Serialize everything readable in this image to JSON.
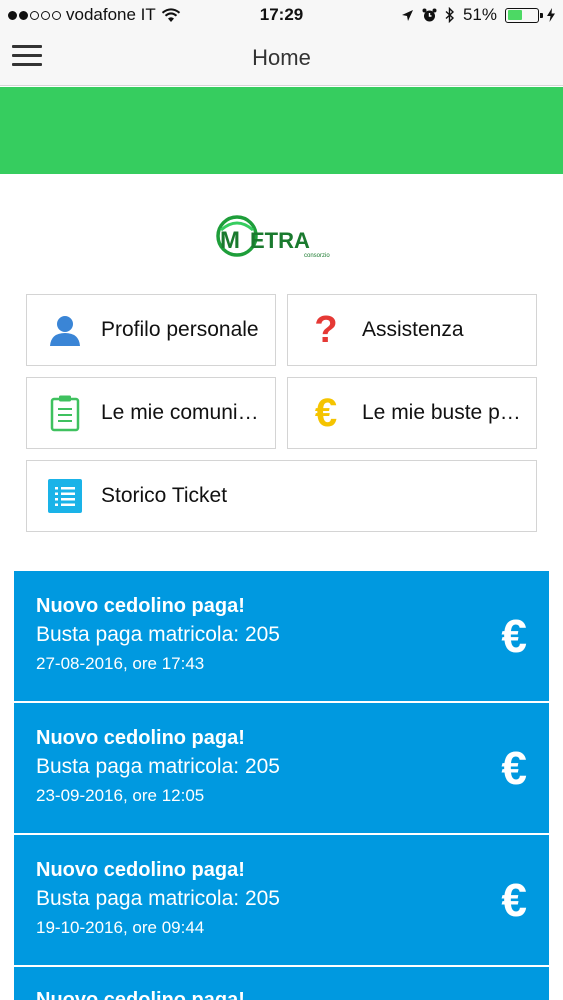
{
  "status_bar": {
    "carrier": "vodafone IT",
    "time": "17:29",
    "battery": "51%",
    "battery_level": 0.51
  },
  "navbar": {
    "title": "Home",
    "menu_icon": "hamburger-menu-icon"
  },
  "logo": {
    "brand": "METRA",
    "tagline": "consorzio"
  },
  "tiles": [
    {
      "label": "Profilo personale",
      "icon": "person-icon",
      "color": "#3a85d6"
    },
    {
      "label": "Assistenza",
      "icon": "question-icon",
      "color": "#e53935"
    },
    {
      "label": "Le mie comunicazioni",
      "icon": "clipboard-icon",
      "color": "#3fc15f"
    },
    {
      "label": "Le mie buste paga",
      "icon": "euro-icon",
      "color": "#f5c400"
    },
    {
      "label": "Storico Ticket",
      "icon": "list-icon",
      "color": "#1ab3e8"
    }
  ],
  "notifications": [
    {
      "title": "Nuovo cedolino paga!",
      "subtitle": "Busta paga matricola: 205",
      "date": "27-08-2016, ore 17:43",
      "icon": "€"
    },
    {
      "title": "Nuovo cedolino paga!",
      "subtitle": "Busta paga matricola: 205",
      "date": "23-09-2016, ore 12:05",
      "icon": "€"
    },
    {
      "title": "Nuovo cedolino paga!",
      "subtitle": "Busta paga matricola: 205",
      "date": "19-10-2016, ore 09:44",
      "icon": "€"
    },
    {
      "title": "Nuovo cedolino paga!"
    }
  ],
  "colors": {
    "accent_green": "#36cd5f",
    "notification_blue": "#0099e0"
  }
}
